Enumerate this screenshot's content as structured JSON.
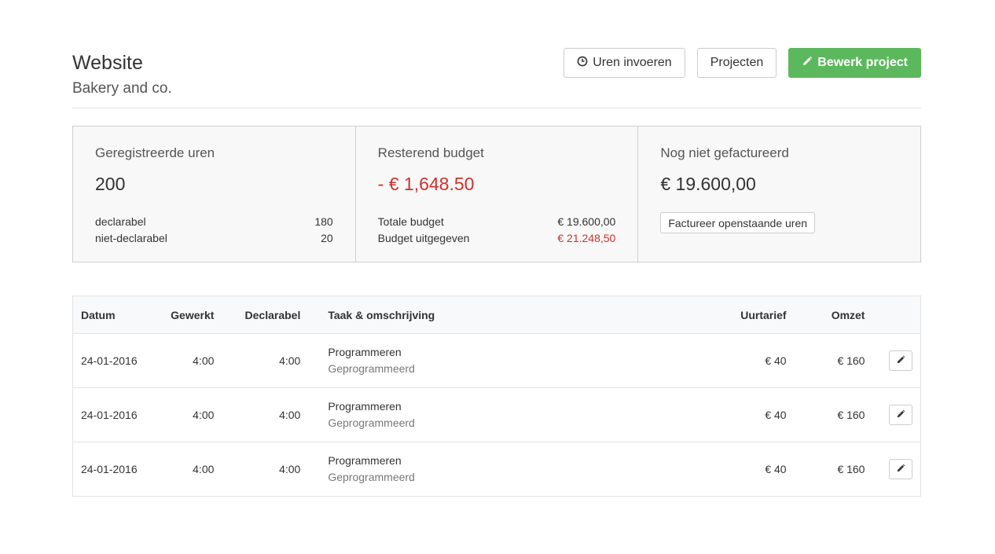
{
  "header": {
    "title": "Website",
    "subtitle": "Bakery and co.",
    "actions": {
      "hours_label": "Uren invoeren",
      "projects_label": "Projecten",
      "edit_label": "Bewerk project"
    }
  },
  "stats": {
    "hours": {
      "label": "Geregistreerde uren",
      "value": "200",
      "rows": [
        {
          "label": "declarabel",
          "value": "180"
        },
        {
          "label": "niet-declarabel",
          "value": "20"
        }
      ]
    },
    "budget": {
      "label": "Resterend budget",
      "value": "- € 1,648.50",
      "rows": [
        {
          "label": "Totale budget",
          "value": "€ 19.600,00"
        },
        {
          "label": "Budget uitgegeven",
          "value": "€ 21.248,50"
        }
      ]
    },
    "uninvoiced": {
      "label": "Nog niet gefactureerd",
      "value": "€ 19.600,00",
      "button_label": "Factureer openstaande uren"
    }
  },
  "table": {
    "columns": {
      "date": "Datum",
      "worked": "Gewerkt",
      "billable": "Declarabel",
      "task": "Taak & omschrijving",
      "rate": "Uurtarief",
      "revenue": "Omzet"
    },
    "rows": [
      {
        "date": "24-01-2016",
        "worked": "4:00",
        "billable": "4:00",
        "task": "Programmeren",
        "description": "Geprogrammeerd",
        "rate": "€ 40",
        "revenue": "€ 160"
      },
      {
        "date": "24-01-2016",
        "worked": "4:00",
        "billable": "4:00",
        "task": "Programmeren",
        "description": "Geprogrammeerd",
        "rate": "€ 40",
        "revenue": "€ 160"
      },
      {
        "date": "24-01-2016",
        "worked": "4:00",
        "billable": "4:00",
        "task": "Programmeren",
        "description": "Geprogrammeerd",
        "rate": "€ 40",
        "revenue": "€ 160"
      }
    ]
  },
  "colors": {
    "accent": "#5cb85c",
    "negative": "#d0312d"
  },
  "icons": {
    "hours_button": "clock-icon",
    "edit_button": "pencil-icon",
    "row_edit": "pencil-icon"
  }
}
